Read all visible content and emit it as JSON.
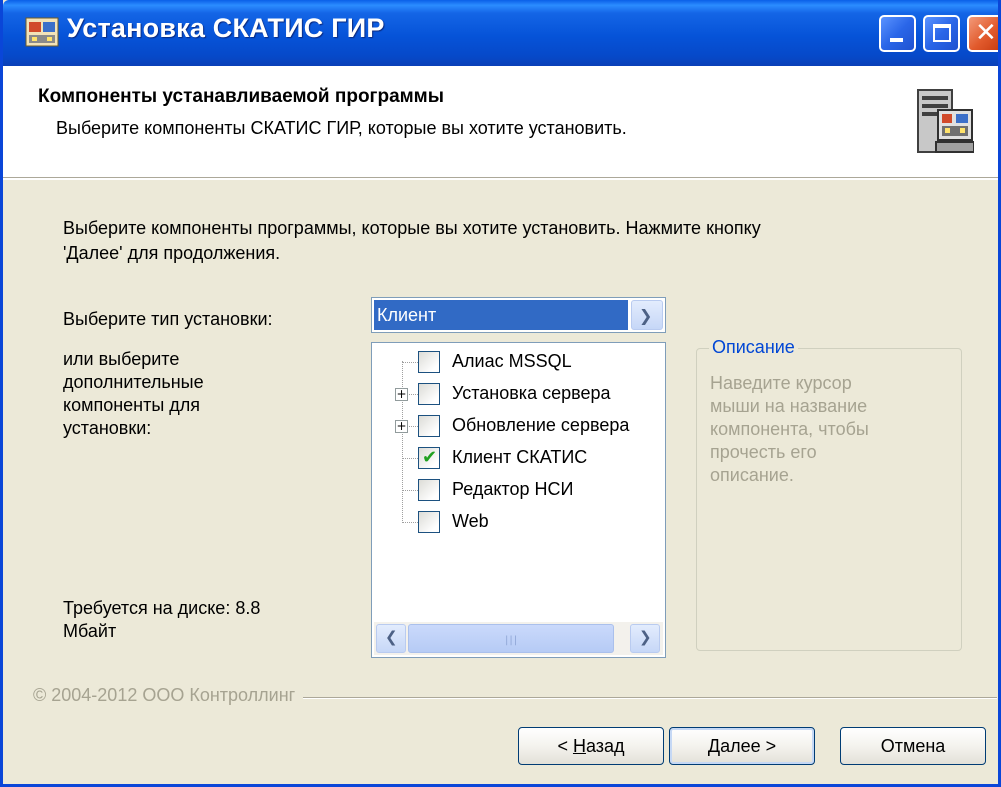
{
  "window": {
    "title": "Установка СКАТИС ГИР"
  },
  "header": {
    "title": "Компоненты устанавливаемой программы",
    "subtitle": "Выберите компоненты СКАТИС ГИР, которые вы хотите установить."
  },
  "body": {
    "intro_line1": "Выберите компоненты программы, которые вы хотите установить. Нажмите кнопку",
    "intro_line2": "'Далее' для продолжения.",
    "install_type_label": "Выберите тип установки:",
    "install_type_value": "Клиент",
    "components_label_1": "или выберите",
    "components_label_2": "дополнительные",
    "components_label_3": "компоненты для",
    "components_label_4": "установки:",
    "disk_label_1": "Требуется на диске: 8.8",
    "disk_label_2": "Мбайт"
  },
  "tree": {
    "items": [
      {
        "label": "Алиас MSSQL",
        "checked": false,
        "expandable": false
      },
      {
        "label": "Установка сервера",
        "checked": false,
        "expandable": true
      },
      {
        "label": "Обновление сервера",
        "checked": false,
        "expandable": true
      },
      {
        "label": "Клиент СКАТИС",
        "checked": true,
        "expandable": false
      },
      {
        "label": "Редактор НСИ",
        "checked": false,
        "expandable": false
      },
      {
        "label": "Web",
        "checked": false,
        "expandable": false
      }
    ],
    "scroll_left_icon": "arrow-left-icon",
    "scroll_right_icon": "arrow-right-icon"
  },
  "description": {
    "legend": "Описание",
    "line1": "Наведите курсор",
    "line2": "мыши на название",
    "line3": "компонента, чтобы",
    "line4": "прочесть его",
    "line5": "описание."
  },
  "footer": {
    "copyright": "© 2004-2012 ООО Контроллинг",
    "back_prefix": "< ",
    "back_key": "Н",
    "back_rest": "азад",
    "next_key": "Д",
    "next_rest": "алее >",
    "cancel": "Отмена"
  },
  "colors": {
    "titlebar": "#0653d8",
    "dialog_bg": "#ece9d8",
    "selection": "#316ac5",
    "legend": "#0046d5",
    "disabled_text": "#a6a391"
  }
}
